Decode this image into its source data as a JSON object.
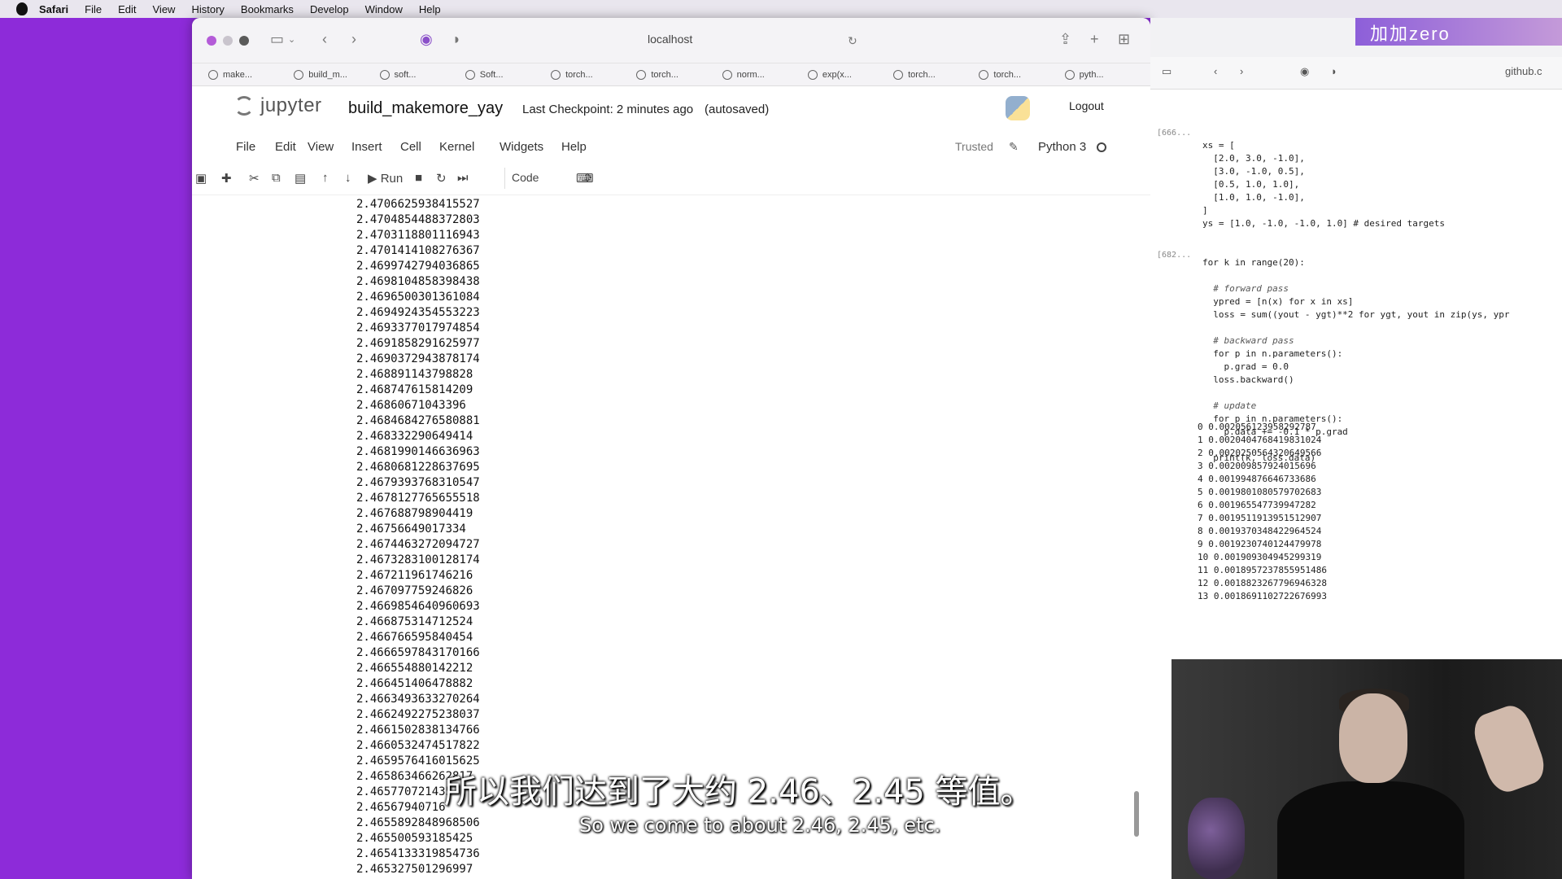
{
  "menubar": {
    "items": [
      "Safari",
      "File",
      "Edit",
      "View",
      "History",
      "Bookmarks",
      "Develop",
      "Window",
      "Help"
    ]
  },
  "browser": {
    "url": "localhost",
    "bookmarks": [
      "make...",
      "build_m...",
      "soft...",
      "Soft...",
      "torch...",
      "torch...",
      "norm...",
      "exp(x...",
      "torch...",
      "torch...",
      "pyth..."
    ]
  },
  "jupyter": {
    "logo_text": "jupyter",
    "notebook_name": "build_makemore_yay",
    "checkpoint": "Last Checkpoint: 2 minutes ago",
    "autosaved": "(autosaved)",
    "logout": "Logout",
    "menu": [
      "File",
      "Edit",
      "View",
      "Insert",
      "Cell",
      "Kernel",
      "Widgets",
      "Help"
    ],
    "trusted": "Trusted",
    "kernel": "Python 3",
    "toolbar": {
      "run_label": "Run",
      "cell_type": "Code"
    }
  },
  "output_lines": [
    "2.4706625938415527",
    "2.4704854488372803",
    "2.4703118801116943",
    "2.4701414108276367",
    "2.4699742794036865",
    "2.4698104858398438",
    "2.4696500301361084",
    "2.4694924354553223",
    "2.4693377017974854",
    "2.4691858291625977",
    "2.4690372943878174",
    "2.468891143798828",
    "2.468747615814209",
    "2.46860671043396",
    "2.4684684276580881",
    "2.468332290649414",
    "2.4681990146636963",
    "2.4680681228637695",
    "2.4679393768310547",
    "2.4678127765655518",
    "2.467688798904419",
    "2.46756649017334",
    "2.4674463272094727",
    "2.4673283100128174",
    "2.467211961746216",
    "2.467097759246826",
    "2.4669854640960693",
    "2.466875314712524",
    "2.466766595840454",
    "2.4666597843170166",
    "2.466554880142212",
    "2.466451406478882",
    "2.4663493633270264",
    "2.4662492275238037",
    "2.4661502838134766",
    "2.4660532474517822",
    "2.4659576416015625",
    "2.465863466262817",
    "2.465770721435",
    "2.46567940716",
    "2.4655892848968506",
    "2.465500593185425",
    "2.4654133319854736",
    "2.465327501296997",
    "2.465242624282837"
  ],
  "subtitles": {
    "zh": "所以我们达到了大约 2.46、2.45 等值。",
    "en": "So we come to about 2.46, 2.45, etc."
  },
  "right_window": {
    "badge": "加加zero",
    "url": "github.c",
    "prompts": [
      "[666...",
      "[682..."
    ],
    "code": [
      "xs = [",
      "  [2.0, 3.0, -1.0],",
      "  [3.0, -1.0, 0.5],",
      "  [0.5, 1.0, 1.0],",
      "  [1.0, 1.0, -1.0],",
      "]",
      "ys = [1.0, -1.0, -1.0, 1.0] # desired targets",
      "",
      "",
      "for k in range(20):",
      "",
      "  # forward pass",
      "  ypred = [n(x) for x in xs]",
      "  loss = sum((yout - ygt)**2 for ygt, yout in zip(ys, ypr",
      "",
      "  # backward pass",
      "  for p in n.parameters():",
      "    p.grad = 0.0",
      "  loss.backward()",
      "",
      "  # update",
      "  for p in n.parameters():",
      "    p.data += -0.1 * p.grad",
      "",
      "  print(k, loss.data)"
    ],
    "output": [
      "0 0.002056123958292787",
      "1 0.0020404768419831024",
      "2 0.0020250564320649566",
      "3 0.002009857924015696",
      "4 0.001994876646733686",
      "5 0.0019801080579702683",
      "6 0.001965547739947282",
      "7 0.0019511913951512907",
      "8 0.0019370348422964524",
      "9 0.0019230740124479978",
      "10 0.001909304945299319",
      "11 0.0018957237855951486",
      "12 0.0018823267796946328",
      "13 0.0018691102722676993"
    ]
  }
}
